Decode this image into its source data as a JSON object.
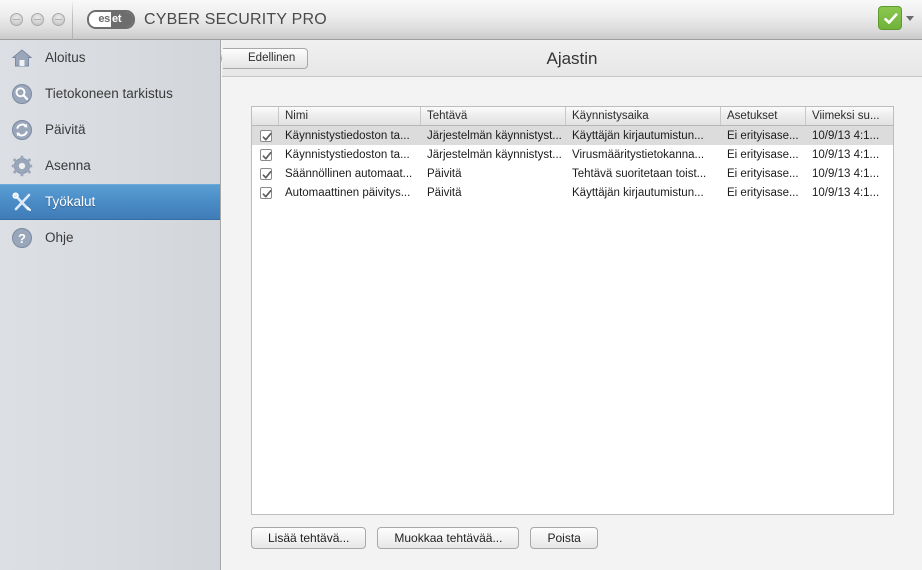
{
  "window": {
    "app_title": "CYBER SECURITY PRO",
    "logo_left": "es",
    "logo_right": "et",
    "traffic_lights": [
      "close",
      "minimize",
      "zoom"
    ],
    "status_icon": "green-check-icon"
  },
  "sidebar": {
    "items": [
      {
        "label": "Aloitus",
        "icon": "home-icon",
        "selected": false
      },
      {
        "label": "Tietokoneen tarkistus",
        "icon": "magnifier-icon",
        "selected": false
      },
      {
        "label": "Päivitä",
        "icon": "refresh-icon",
        "selected": false
      },
      {
        "label": "Asenna",
        "icon": "gear-icon",
        "selected": false
      },
      {
        "label": "Työkalut",
        "icon": "tools-icon",
        "selected": true
      },
      {
        "label": "Ohje",
        "icon": "question-icon",
        "selected": false
      }
    ]
  },
  "main": {
    "back_button": "Edellinen",
    "title": "Ajastin",
    "table": {
      "columns": [
        "",
        "Nimi",
        "Tehtävä",
        "Käynnistysaika",
        "Asetukset",
        "Viimeksi su..."
      ],
      "rows": [
        {
          "checked": true,
          "selected": true,
          "cells": [
            "Käynnistystiedoston ta...",
            "Järjestelmän käynnistyst...",
            "Käyttäjän kirjautumistun...",
            "Ei erityisase...",
            "10/9/13 4:1..."
          ]
        },
        {
          "checked": true,
          "selected": false,
          "cells": [
            "Käynnistystiedoston ta...",
            "Järjestelmän käynnistyst...",
            "Virusmääritystietokanna...",
            "Ei erityisase...",
            "10/9/13 4:1..."
          ]
        },
        {
          "checked": true,
          "selected": false,
          "cells": [
            "Säännöllinen automaat...",
            "Päivitä",
            "Tehtävä suoritetaan toist...",
            "Ei erityisase...",
            "10/9/13 4:1..."
          ]
        },
        {
          "checked": true,
          "selected": false,
          "cells": [
            "Automaattinen päivitys...",
            "Päivitä",
            "Käyttäjän kirjautumistun...",
            "Ei erityisase...",
            "10/9/13 4:1..."
          ]
        }
      ]
    },
    "buttons": [
      {
        "label": "Lisää tehtävä...",
        "name": "add-task-button"
      },
      {
        "label": "Muokkaa tehtävää...",
        "name": "edit-task-button"
      },
      {
        "label": "Poista",
        "name": "delete-task-button"
      }
    ]
  },
  "colors": {
    "accent_selected": "#4a8bc6",
    "status_green": "#7bbd44",
    "sidebar_bg": "#d8dbe0",
    "row_selected": "#dcdcdc"
  }
}
